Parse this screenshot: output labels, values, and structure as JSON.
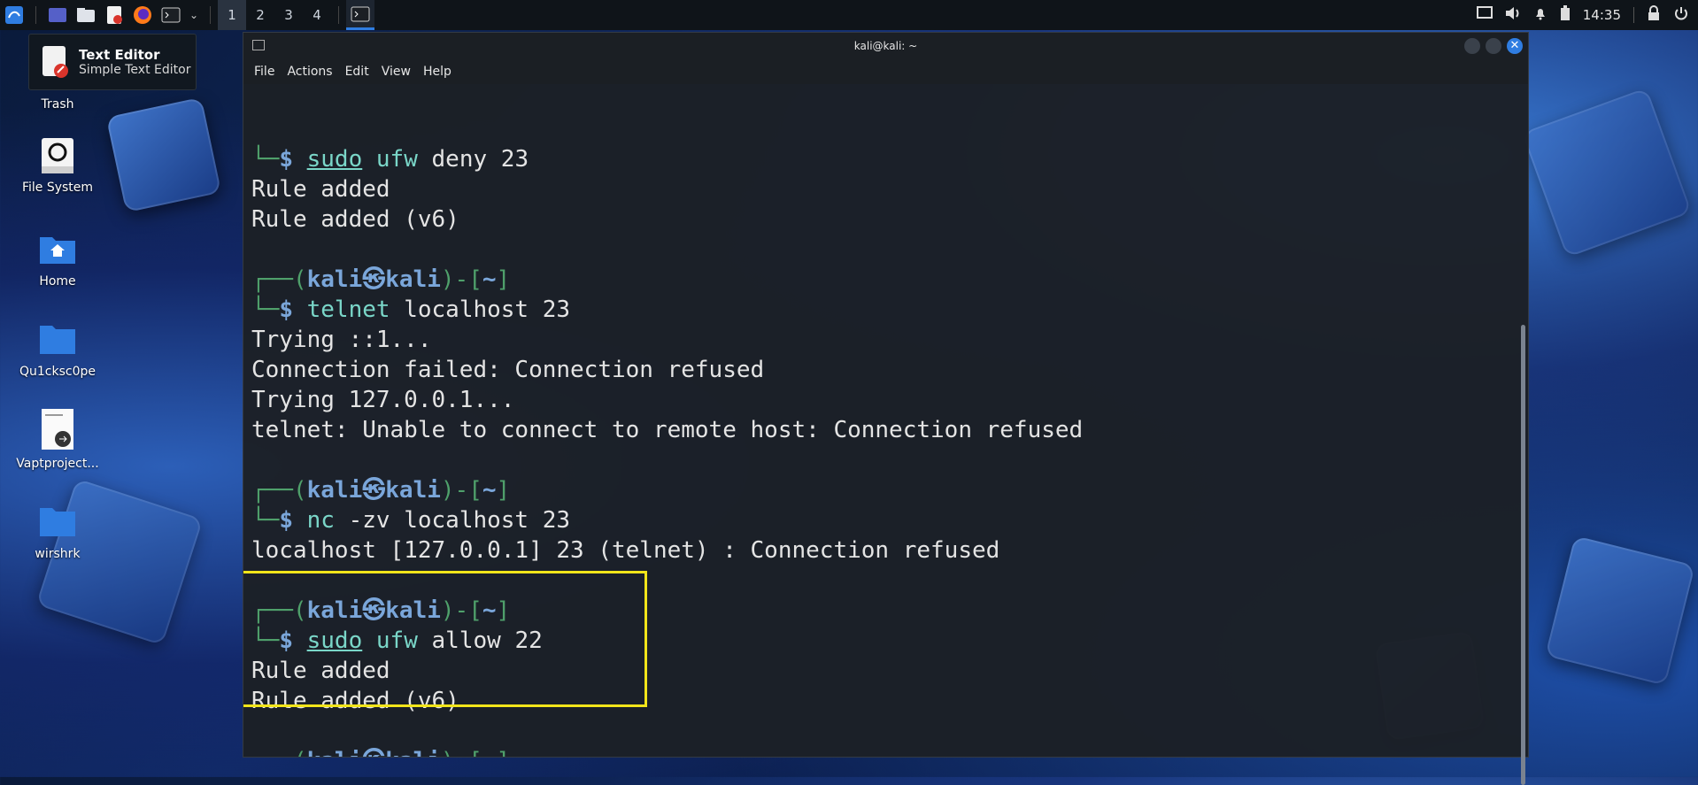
{
  "taskbar": {
    "workspaces": [
      "1",
      "2",
      "3",
      "4"
    ],
    "clock": "14:35"
  },
  "tooltip": {
    "title": "Text Editor",
    "subtitle": "Simple Text Editor"
  },
  "desktop": {
    "icons": [
      {
        "label": "Trash"
      },
      {
        "label": "File System"
      },
      {
        "label": "Home"
      },
      {
        "label": "Qu1cksc0pe"
      },
      {
        "label": "Vaptproject..."
      },
      {
        "label": "wirshrk"
      }
    ]
  },
  "window": {
    "title": "kali@kali: ~",
    "menu": [
      "File",
      "Actions",
      "Edit",
      "View",
      "Help"
    ]
  },
  "terminal": {
    "prompt_user": "kali",
    "prompt_host": "kali",
    "prompt_dir": "~",
    "lines": [
      {
        "kind": "cmd",
        "sudo": "sudo",
        "prog": "ufw",
        "args": " deny 23"
      },
      {
        "kind": "out",
        "text": "Rule added"
      },
      {
        "kind": "out",
        "text": "Rule added (v6)"
      },
      {
        "kind": "blank"
      },
      {
        "kind": "prompt"
      },
      {
        "kind": "cmd",
        "sudo": "",
        "prog": "telnet",
        "args": " localhost 23"
      },
      {
        "kind": "out",
        "text": "Trying ::1..."
      },
      {
        "kind": "out",
        "text": "Connection failed: Connection refused"
      },
      {
        "kind": "out",
        "text": "Trying 127.0.0.1..."
      },
      {
        "kind": "out",
        "text": "telnet: Unable to connect to remote host: Connection refused"
      },
      {
        "kind": "blank"
      },
      {
        "kind": "prompt"
      },
      {
        "kind": "cmd",
        "sudo": "",
        "prog": "nc",
        "args": " -zv localhost 23"
      },
      {
        "kind": "out",
        "text": "localhost [127.0.0.1] 23 (telnet) : Connection refused"
      },
      {
        "kind": "blank"
      },
      {
        "kind": "prompt"
      },
      {
        "kind": "cmd",
        "sudo": "sudo",
        "prog": "ufw",
        "args": " allow 22"
      },
      {
        "kind": "out",
        "text": "Rule added"
      },
      {
        "kind": "out",
        "text": "Rule added (v6)"
      },
      {
        "kind": "blank"
      },
      {
        "kind": "prompt"
      },
      {
        "kind": "input"
      }
    ]
  }
}
